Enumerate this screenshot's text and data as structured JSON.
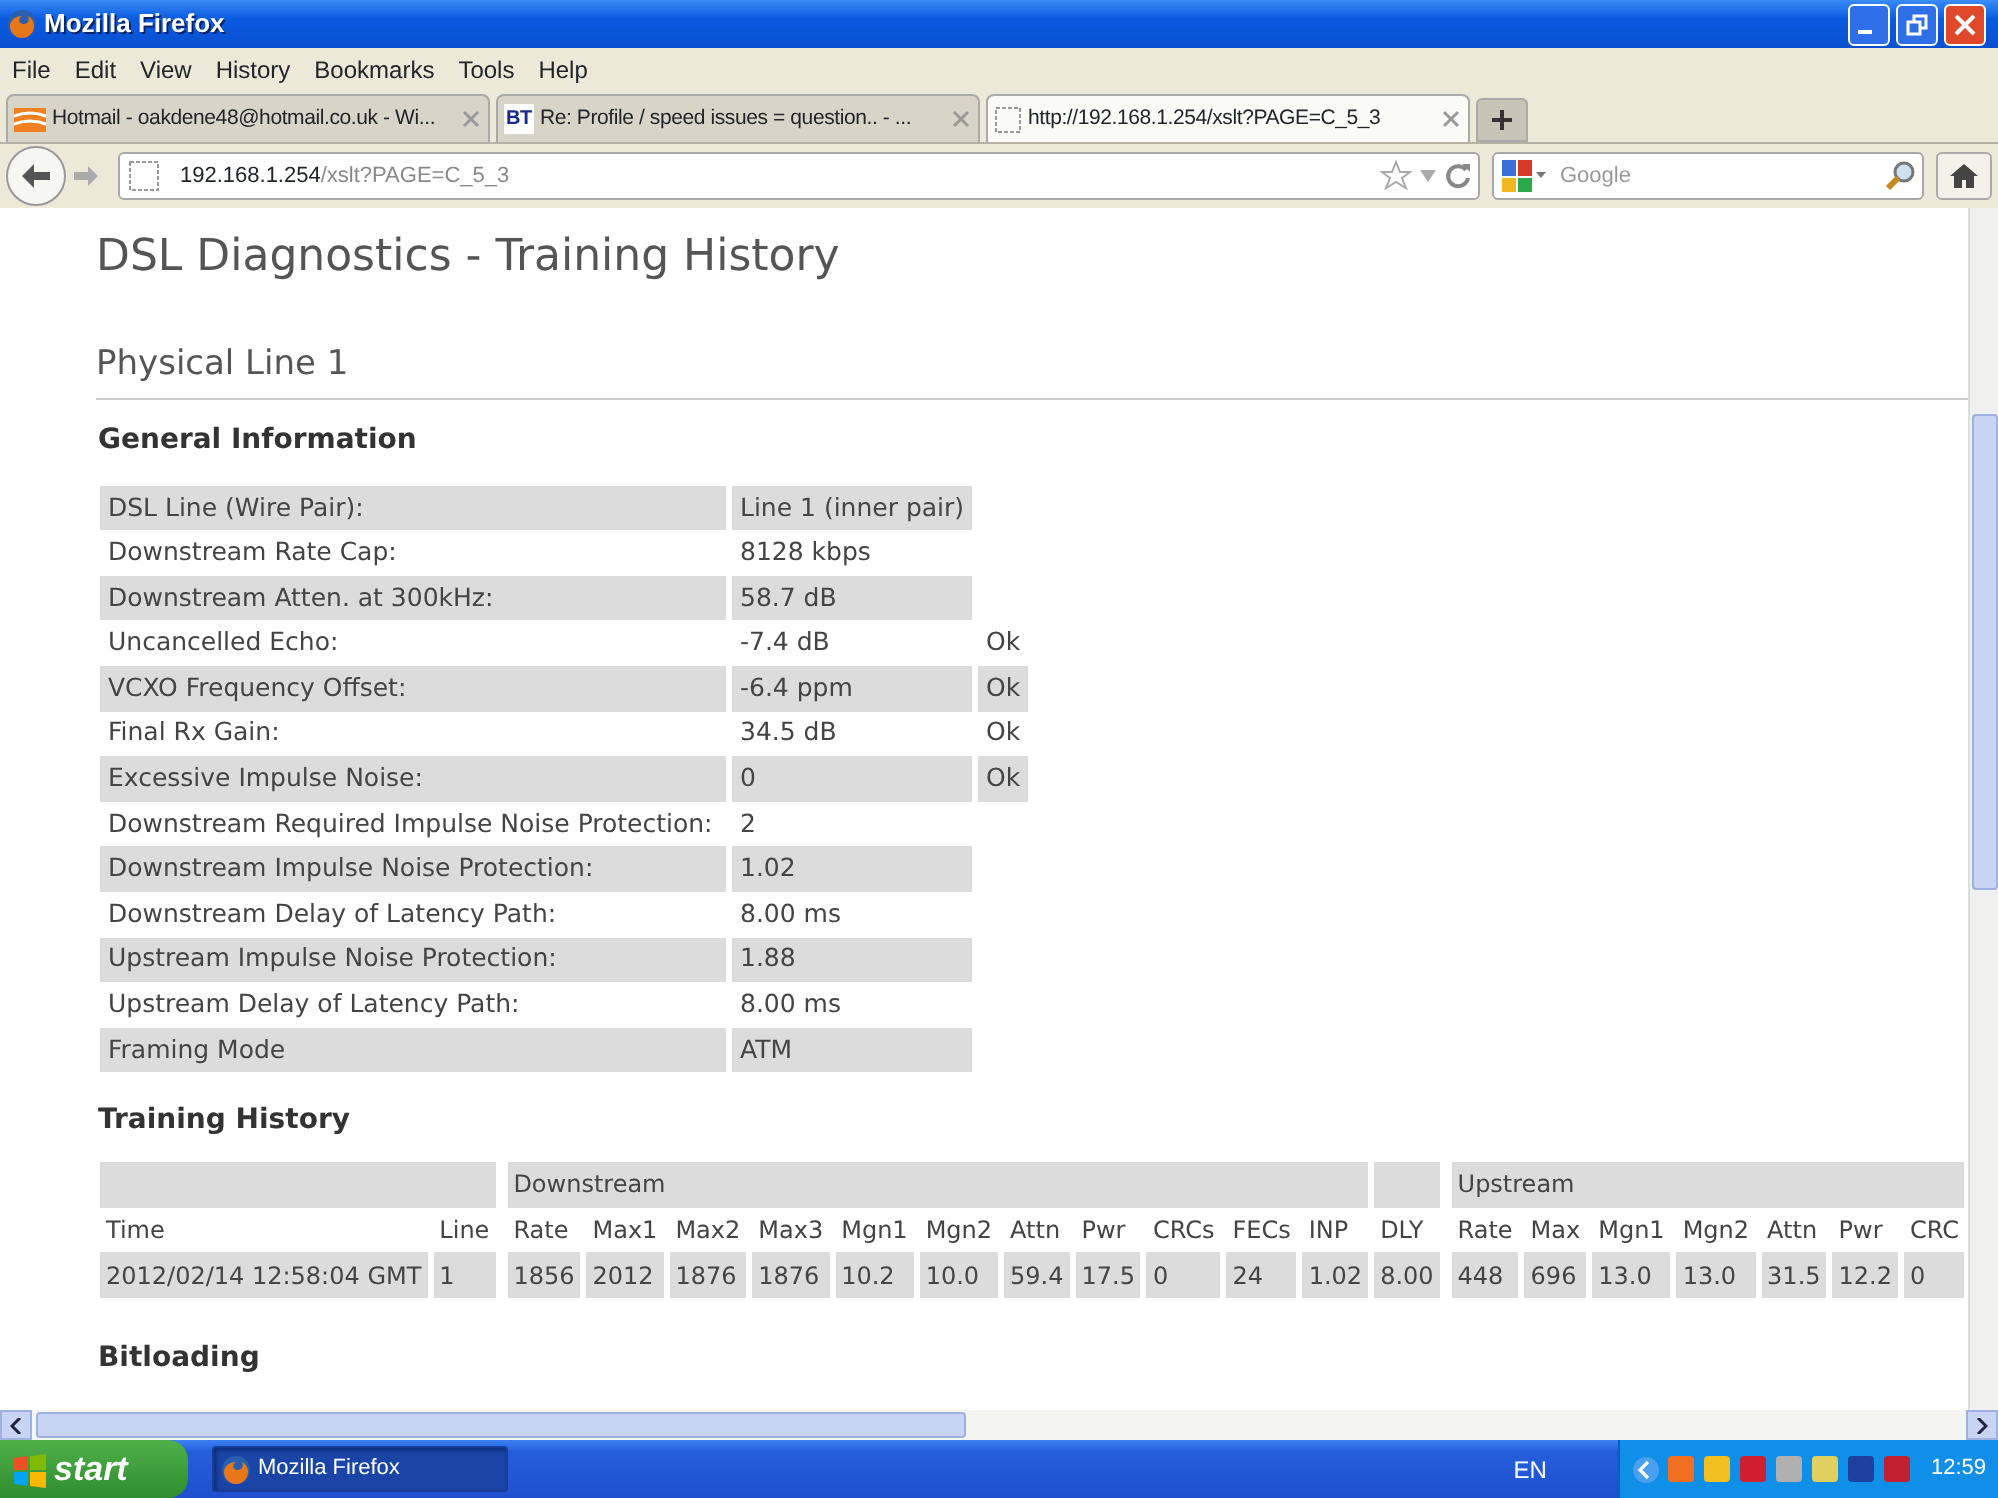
{
  "window": {
    "title": "Mozilla Firefox"
  },
  "menu": [
    "File",
    "Edit",
    "View",
    "History",
    "Bookmarks",
    "Tools",
    "Help"
  ],
  "tabs": [
    {
      "label": "Hotmail - oakdene48@hotmail.co.uk - Wi...",
      "kind": "mail",
      "selected": false
    },
    {
      "label": "Re: Profile / speed issues = question.. - ...",
      "kind": "bt",
      "icon_text": "BT",
      "selected": false
    },
    {
      "label": "http://192.168.1.254/xslt?PAGE=C_5_3",
      "kind": "blank",
      "selected": true
    }
  ],
  "address": {
    "host": "192.168.1.254",
    "path": "/xslt?PAGE=C_5_3"
  },
  "search": {
    "placeholder": "Google"
  },
  "page": {
    "title": "DSL Diagnostics - Training History",
    "section": "Physical Line 1",
    "general_heading": "General Information",
    "general_rows": [
      {
        "label": "DSL Line (Wire Pair):",
        "value": "Line 1 (inner pair)"
      },
      {
        "label": "Downstream Rate Cap:",
        "value": "8128 kbps"
      },
      {
        "label": "Downstream Atten. at 300kHz:",
        "value": "58.7 dB"
      },
      {
        "label": "Uncancelled Echo:",
        "value": "-7.4 dB",
        "status": "Ok"
      },
      {
        "label": "VCXO Frequency Offset:",
        "value": "-6.4 ppm",
        "status": "Ok"
      },
      {
        "label": "Final Rx Gain:",
        "value": "34.5 dB",
        "status": "Ok"
      },
      {
        "label": "Excessive Impulse Noise:",
        "value": "0",
        "status": "Ok"
      },
      {
        "label": "Downstream Required Impulse Noise Protection:",
        "value": "2"
      },
      {
        "label": "Downstream Impulse Noise Protection:",
        "value": "1.02"
      },
      {
        "label": "Downstream Delay of Latency Path:",
        "value": "8.00 ms"
      },
      {
        "label": "Upstream Impulse Noise Protection:",
        "value": "1.88"
      },
      {
        "label": "Upstream Delay of Latency Path:",
        "value": "8.00 ms"
      },
      {
        "label": "Framing Mode",
        "value": "ATM"
      }
    ],
    "training_heading": "Training History",
    "training": {
      "blocks": [
        {
          "columns": [
            "Time",
            "Line"
          ]
        },
        {
          "heading": "Downstream",
          "columns": [
            "Rate",
            "Max1",
            "Max2",
            "Max3",
            "Mgn1",
            "Mgn2",
            "Attn",
            "Pwr",
            "CRCs",
            "FECs",
            "INP"
          ]
        },
        {
          "columns": [
            "DLY"
          ]
        },
        {
          "heading": "Upstream",
          "columns": [
            "Rate",
            "Max",
            "Mgn1",
            "Mgn2",
            "Attn",
            "Pwr",
            "CRC"
          ]
        }
      ],
      "rows": [
        [
          "2012/02/14 12:58:04 GMT",
          "1",
          "1856",
          "2012",
          "1876",
          "1876",
          "10.2",
          "10.0",
          "59.4",
          "17.5",
          "0",
          "24",
          "1.02",
          "8.00",
          "448",
          "696",
          "13.0",
          "13.0",
          "31.5",
          "12.2",
          "0"
        ]
      ]
    },
    "bitloading_heading": "Bitloading"
  },
  "taskbar": {
    "start": "start",
    "tasks": [
      {
        "label": "Mozilla Firefox",
        "selected": true
      }
    ],
    "language": "EN",
    "clock": "12:59"
  }
}
